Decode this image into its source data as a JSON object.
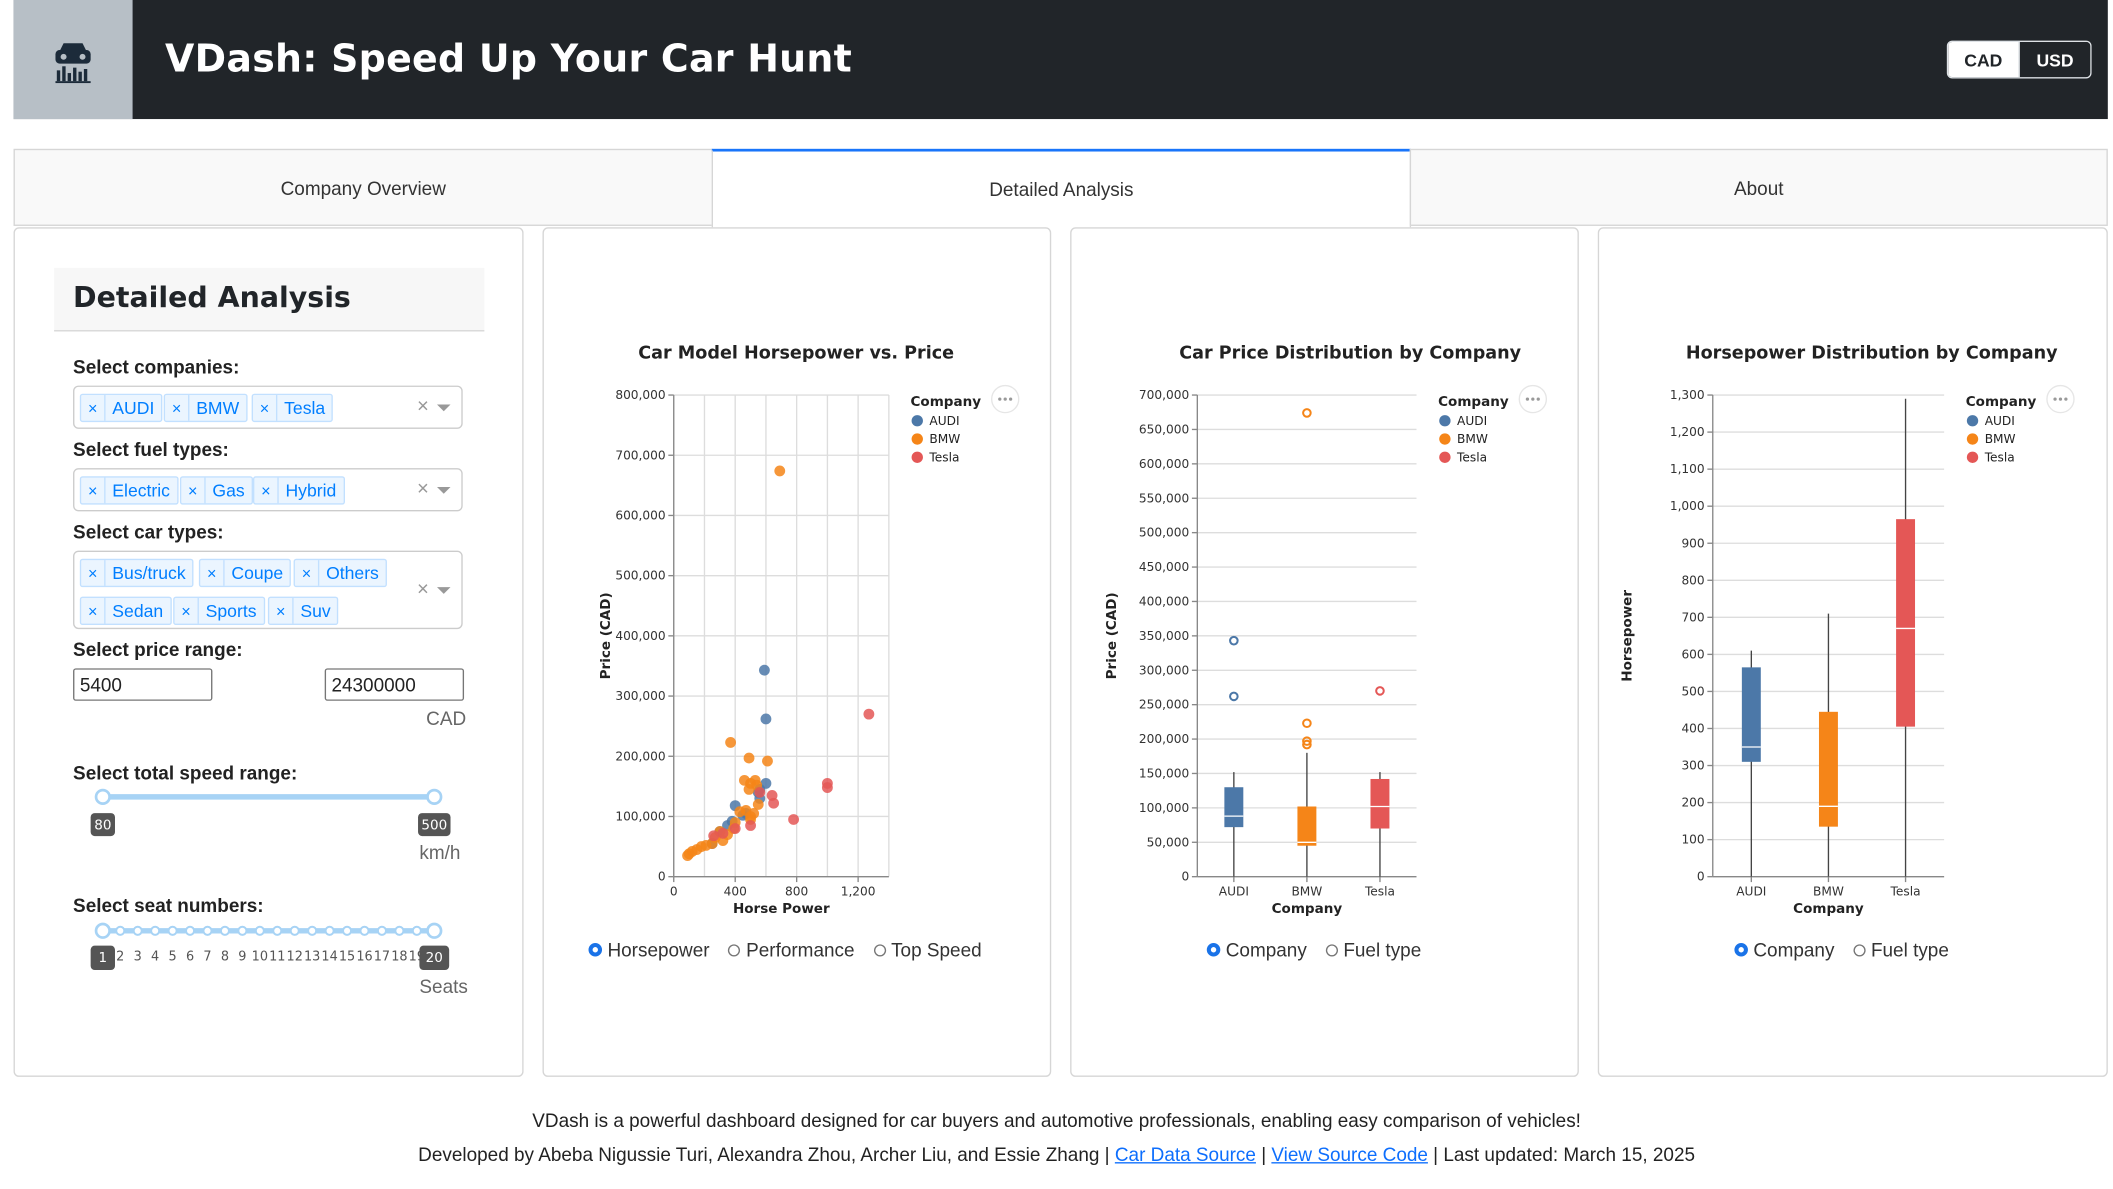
{
  "header": {
    "title": "VDash: Speed Up Your Car Hunt",
    "logo_icon": "car-chart-icon",
    "currency": {
      "options": [
        "CAD",
        "USD"
      ],
      "selected": "CAD"
    }
  },
  "tabs": [
    {
      "label": "Company Overview",
      "active": false
    },
    {
      "label": "Detailed Analysis",
      "active": true
    },
    {
      "label": "About",
      "active": false
    }
  ],
  "sidebar": {
    "title": "Detailed Analysis",
    "companies": {
      "label": "Select companies:",
      "selected": [
        "AUDI",
        "BMW",
        "Tesla"
      ]
    },
    "fuel_types": {
      "label": "Select fuel types:",
      "selected": [
        "Electric",
        "Gas",
        "Hybrid"
      ]
    },
    "car_types": {
      "label": "Select car types:",
      "selected": [
        "Bus/truck",
        "Coupe",
        "Others",
        "Sedan",
        "Sports",
        "Suv"
      ]
    },
    "price_range": {
      "label": "Select price range:",
      "min": "5400",
      "max": "24300000",
      "unit": "CAD"
    },
    "speed_range": {
      "label": "Select total speed range:",
      "min": "80",
      "max": "500",
      "unit": "km/h"
    },
    "seat_numbers": {
      "label": "Select seat numbers:",
      "min": "1",
      "max": "20",
      "marks": [
        "2",
        "3",
        "4",
        "5",
        "6",
        "7",
        "8",
        "9",
        "10",
        "11",
        "12",
        "13",
        "14",
        "15",
        "16",
        "17",
        "18",
        "19"
      ],
      "unit": "Seats"
    }
  },
  "colors": {
    "AUDI": "#4c78a8",
    "BMW": "#f58518",
    "Tesla": "#e45756",
    "accent": "#1975fa"
  },
  "chart_data": [
    {
      "type": "scatter",
      "title": "Car Model Horsepower vs. Price",
      "xlabel": "Horse Power",
      "ylabel": "Price (CAD)",
      "xlim": [
        0,
        1400
      ],
      "ylim": [
        0,
        800000
      ],
      "x_ticks": [
        "0",
        "400",
        "800",
        "1,200"
      ],
      "y_ticks": [
        "0",
        "100,000",
        "200,000",
        "300,000",
        "400,000",
        "500,000",
        "600,000",
        "700,000",
        "800,000"
      ],
      "legend": {
        "title": "Company",
        "entries": [
          "AUDI",
          "BMW",
          "Tesla"
        ]
      },
      "series": [
        {
          "name": "AUDI",
          "x": [
            590,
            600,
            600,
            400,
            450,
            560,
            470,
            560,
            550,
            300,
            250,
            350,
            380
          ],
          "y": [
            343000,
            262000,
            155000,
            118000,
            102000,
            145000,
            105000,
            130000,
            140000,
            75000,
            55000,
            85000,
            92000
          ]
        },
        {
          "name": "BMW",
          "x": [
            690,
            370,
            490,
            610,
            530,
            500,
            460,
            490,
            540,
            500,
            550,
            520,
            470,
            430,
            390,
            350,
            300,
            250,
            210,
            180,
            150,
            120,
            100,
            90,
            320,
            270,
            400,
            500
          ],
          "y": [
            674000,
            223000,
            197000,
            192000,
            160000,
            155000,
            160000,
            145000,
            152000,
            100000,
            120000,
            105000,
            110000,
            108000,
            80000,
            70000,
            75000,
            55000,
            52000,
            50000,
            45000,
            42000,
            38000,
            35000,
            60000,
            65000,
            90000,
            95000
          ]
        },
        {
          "name": "Tesla",
          "x": [
            1270,
            1000,
            1000,
            640,
            650,
            780,
            560,
            500,
            400,
            320,
            260
          ],
          "y": [
            270000,
            155000,
            148000,
            135000,
            122000,
            95000,
            140000,
            85000,
            80000,
            72000,
            68000
          ]
        }
      ]
    },
    {
      "type": "box",
      "title": "Car Price Distribution by Company",
      "xlabel": "Company",
      "ylabel": "Price (CAD)",
      "ylim": [
        0,
        700000
      ],
      "categories": [
        "AUDI",
        "BMW",
        "Tesla"
      ],
      "y_ticks": [
        "0",
        "50,000",
        "100,000",
        "150,000",
        "200,000",
        "250,000",
        "300,000",
        "350,000",
        "400,000",
        "450,000",
        "500,000",
        "550,000",
        "600,000",
        "650,000",
        "700,000"
      ],
      "legend": {
        "title": "Company",
        "entries": [
          "AUDI",
          "BMW",
          "Tesla"
        ]
      },
      "boxes": [
        {
          "name": "AUDI",
          "min": 0,
          "q1": 72000,
          "median": 88000,
          "q3": 130000,
          "max": 152000,
          "outliers": [
            343000,
            262000
          ]
        },
        {
          "name": "BMW",
          "min": 0,
          "q1": 45000,
          "median": 50000,
          "q3": 102000,
          "max": 180000,
          "outliers": [
            674000,
            223000,
            197000,
            192000
          ]
        },
        {
          "name": "Tesla",
          "min": 0,
          "q1": 70000,
          "median": 102000,
          "q3": 142000,
          "max": 152000,
          "outliers": [
            270000
          ]
        }
      ]
    },
    {
      "type": "box",
      "title": "Horsepower Distribution by Company",
      "xlabel": "Company",
      "ylabel": "Horsepower",
      "ylim": [
        0,
        1300
      ],
      "categories": [
        "AUDI",
        "BMW",
        "Tesla"
      ],
      "y_ticks": [
        "0",
        "100",
        "200",
        "300",
        "400",
        "500",
        "600",
        "700",
        "800",
        "900",
        "1,000",
        "1,100",
        "1,200",
        "1,300"
      ],
      "legend": {
        "title": "Company",
        "entries": [
          "AUDI",
          "BMW",
          "Tesla"
        ]
      },
      "boxes": [
        {
          "name": "AUDI",
          "min": 0,
          "q1": 310,
          "median": 350,
          "q3": 565,
          "max": 610,
          "outliers": []
        },
        {
          "name": "BMW",
          "min": 0,
          "q1": 135,
          "median": 190,
          "q3": 445,
          "max": 710,
          "outliers": []
        },
        {
          "name": "Tesla",
          "min": 0,
          "q1": 405,
          "median": 670,
          "q3": 965,
          "max": 1290,
          "outliers": []
        }
      ]
    }
  ],
  "chart_controls": {
    "scatter": {
      "options": [
        "Horsepower",
        "Performance",
        "Top Speed"
      ],
      "selected": "Horsepower"
    },
    "price_box": {
      "options": [
        "Company",
        "Fuel type"
      ],
      "selected": "Company"
    },
    "hp_box": {
      "options": [
        "Company",
        "Fuel type"
      ],
      "selected": "Company"
    }
  },
  "footer": {
    "line1": "VDash is a powerful dashboard designed for car buyers and automotive professionals, enabling easy comparison of vehicles!",
    "line2_prefix": "Developed by Abeba Nigussie Turi, Alexandra Zhou, Archer Liu, and Essie Zhang | ",
    "link1": "Car Data Source",
    "sep": " | ",
    "link2": "View Source Code",
    "line2_suffix": " | Last updated: March 15, 2025"
  }
}
